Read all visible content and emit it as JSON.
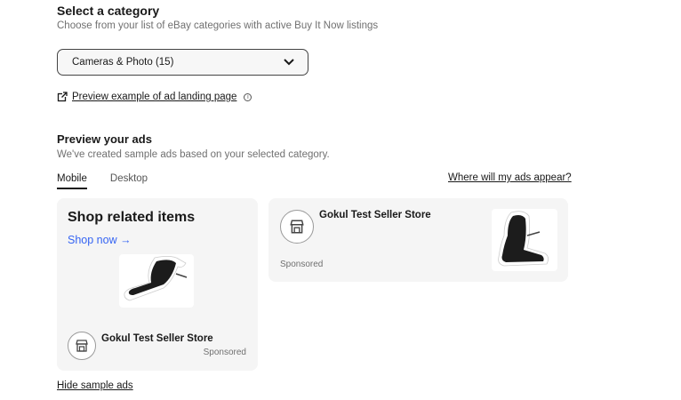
{
  "category": {
    "title": "Select a category",
    "subtitle": "Choose from your list of eBay categories with active Buy It Now listings",
    "selected": "Cameras & Photo (15)",
    "preview_link": "Preview example of ad landing page"
  },
  "preview": {
    "title": "Preview your ads",
    "subtitle": "We've created sample ads based on your selected category.",
    "tabs": [
      {
        "label": "Mobile",
        "active": true
      },
      {
        "label": "Desktop",
        "active": false
      }
    ],
    "where_link": "Where will my ads appear?"
  },
  "mobile_ad": {
    "heading": "Shop related items",
    "shop_now": "Shop now →",
    "store_name": "Gokul Test Seller Store",
    "sponsored": "Sponsored"
  },
  "desktop_ad": {
    "store_name": "Gokul Test Seller Store",
    "sponsored": "Sponsored"
  },
  "hide_link": "Hide sample ads",
  "colors": {
    "link_blue": "#3665f3",
    "card_bg": "#f5f5f5",
    "text": "#191919",
    "muted": "#707070"
  }
}
